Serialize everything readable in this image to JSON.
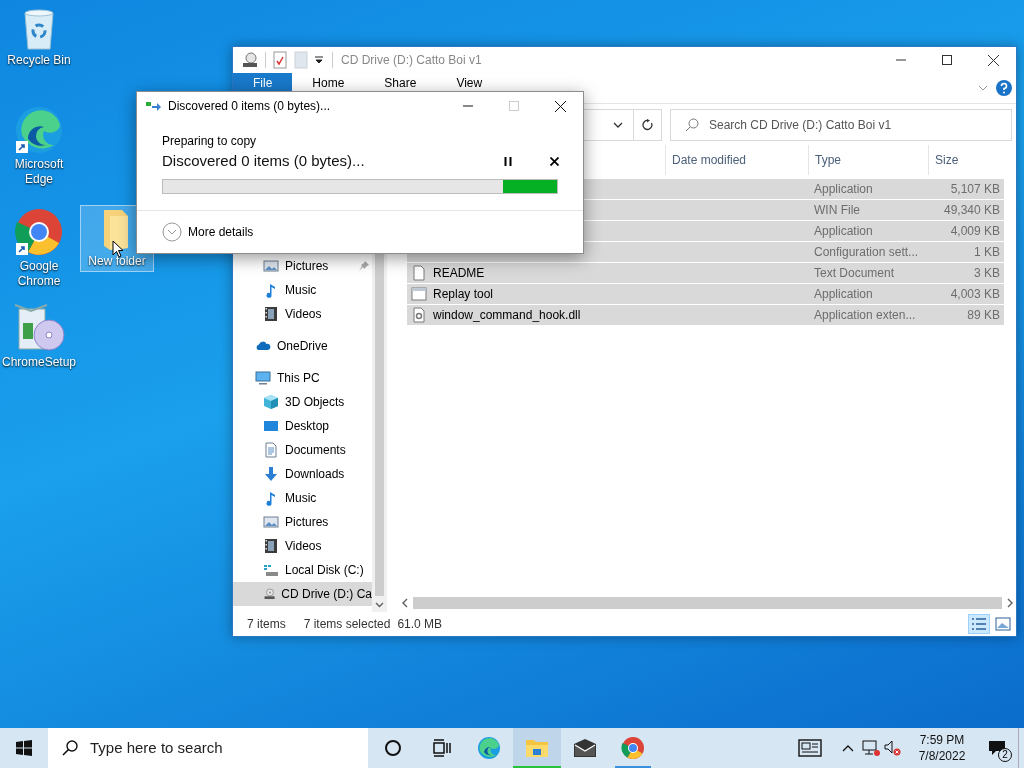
{
  "desktop_icons": [
    {
      "kind": "recycle",
      "label": "Recycle Bin",
      "selected": false
    },
    {
      "kind": "edge",
      "label": "Microsoft Edge",
      "selected": false
    },
    {
      "kind": "chrome",
      "label": "Google Chrome",
      "selected": false
    },
    {
      "kind": "folder",
      "label": "New folder",
      "selected": true
    },
    {
      "kind": "setup",
      "label": "ChromeSetup",
      "selected": false
    }
  ],
  "explorer": {
    "title": "CD Drive (D:) Catto Boi v1",
    "ribbon_tabs": [
      {
        "label": "File",
        "selected": true
      },
      {
        "label": "Home",
        "selected": false
      },
      {
        "label": "Share",
        "selected": false
      },
      {
        "label": "View",
        "selected": false
      }
    ],
    "search": {
      "placeholder": "Search CD Drive (D:) Catto Boi v1"
    },
    "nav": {
      "quick_access": [
        {
          "kind": "pictures",
          "label": "Pictures",
          "pinned": true,
          "selected": false
        },
        {
          "kind": "music",
          "label": "Music",
          "pinned": false,
          "selected": false
        },
        {
          "kind": "videos",
          "label": "Videos",
          "pinned": false,
          "selected": false
        }
      ],
      "locations": [
        {
          "kind": "onedrive",
          "label": "OneDrive",
          "selected": false
        },
        {
          "kind": "pc",
          "label": "This PC",
          "selected": false,
          "children": [
            {
              "kind": "cube",
              "label": "3D Objects",
              "selected": false
            },
            {
              "kind": "desktop",
              "label": "Desktop",
              "selected": false
            },
            {
              "kind": "documents",
              "label": "Documents",
              "selected": false
            },
            {
              "kind": "downloads",
              "label": "Downloads",
              "selected": false
            },
            {
              "kind": "music",
              "label": "Music",
              "selected": false
            },
            {
              "kind": "pictures",
              "label": "Pictures",
              "selected": false
            },
            {
              "kind": "videos",
              "label": "Videos",
              "selected": false
            },
            {
              "kind": "localdisk",
              "label": "Local Disk (C:)",
              "selected": false
            },
            {
              "kind": "cd",
              "label": "CD Drive (D:) Ca",
              "selected": true
            }
          ]
        }
      ]
    },
    "columns": [
      "Date modified",
      "Type",
      "Size"
    ],
    "files": [
      {
        "type": "Application",
        "size": "5,107 KB",
        "selected": true
      },
      {
        "type": "WIN File",
        "size": "49,340 KB",
        "selected": true
      },
      {
        "type": "Application",
        "size": "4,009 KB",
        "selected": true
      },
      {
        "type": "Configuration sett...",
        "size": "1 KB",
        "selected": true
      },
      {
        "kind": "text",
        "name": "README",
        "type": "Text Document",
        "size": "3 KB",
        "selected": true
      },
      {
        "kind": "app",
        "name": "Replay tool",
        "type": "Application",
        "size": "4,003 KB",
        "selected": true
      },
      {
        "kind": "dll",
        "name": "window_command_hook.dll",
        "type": "Application exten...",
        "size": "89 KB",
        "selected": true
      }
    ],
    "status": {
      "count": "7 items",
      "selection": "7 items selected",
      "size": "61.0 MB"
    },
    "views": [
      {
        "kind": "details",
        "selected": true
      },
      {
        "kind": "large",
        "selected": false
      }
    ]
  },
  "copy_dialog": {
    "title": "Discovered 0 items (0 bytes)...",
    "heading": "Preparing to copy",
    "status": "Discovered 0 items (0 bytes)...",
    "progress": {
      "indeterminate": true
    },
    "details": {
      "label": "More details",
      "expanded": false
    }
  },
  "taskbar": {
    "search": {
      "placeholder": "Type here to search"
    },
    "apps": [
      {
        "kind": "cortana",
        "running": false,
        "focused": false
      },
      {
        "kind": "taskview",
        "running": false,
        "focused": false
      },
      {
        "kind": "edge",
        "running": false,
        "focused": false
      },
      {
        "kind": "explorer",
        "running": true,
        "focused": true
      },
      {
        "kind": "mail",
        "running": false,
        "focused": false
      },
      {
        "kind": "chrome",
        "running": true,
        "focused": false
      }
    ],
    "time": "7:59 PM",
    "date": "7/8/2022",
    "notifications": "2"
  }
}
